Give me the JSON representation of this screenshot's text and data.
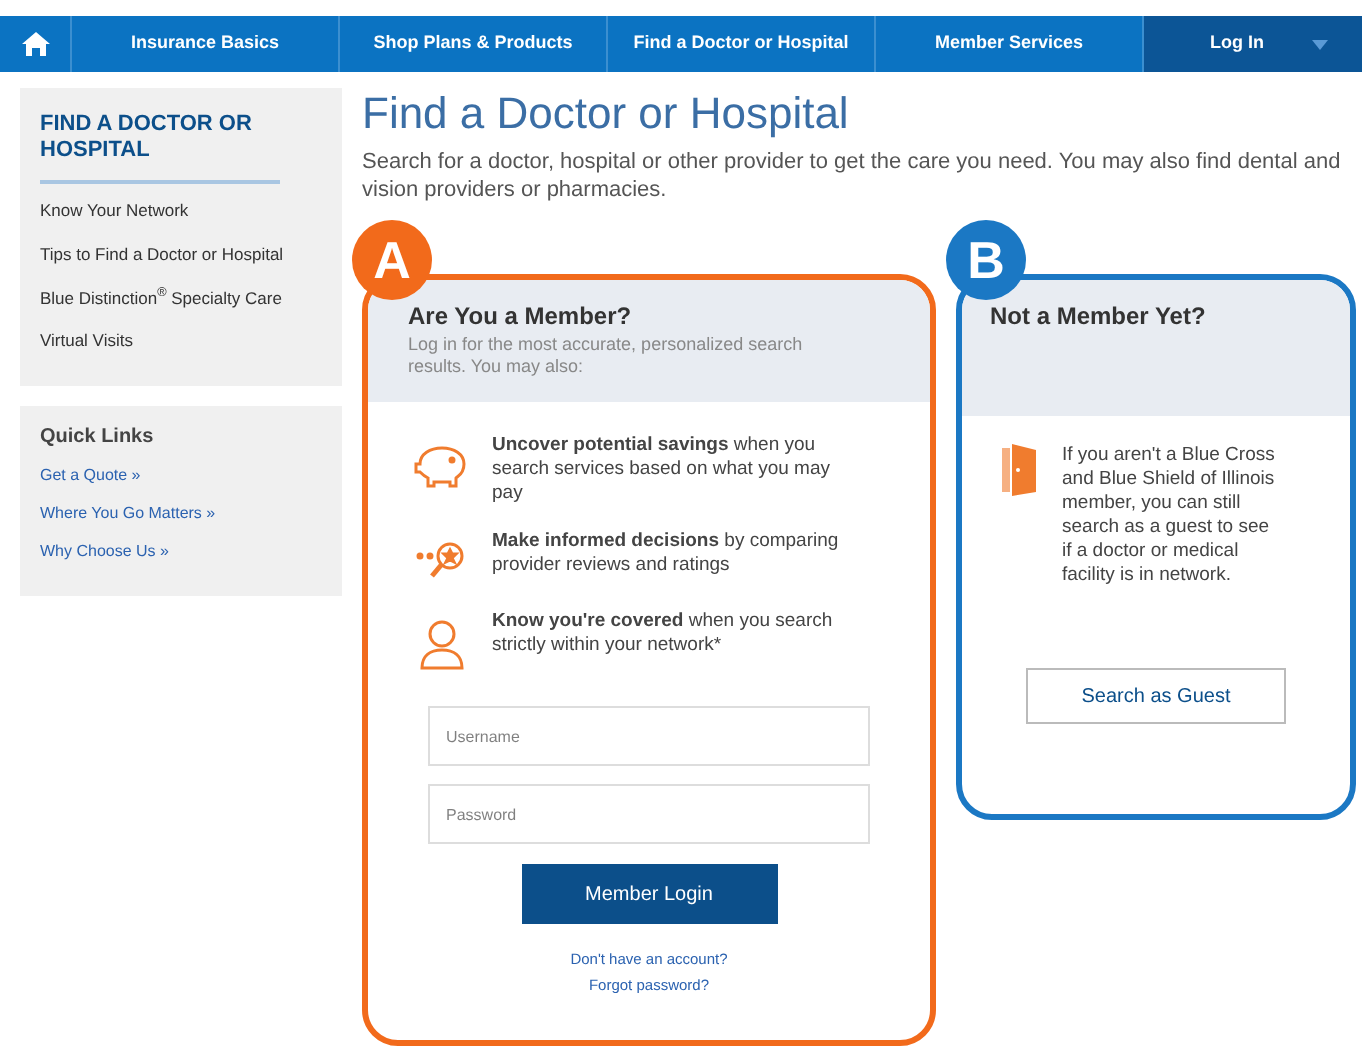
{
  "nav": {
    "items": [
      {
        "label": "Insurance Basics"
      },
      {
        "label": "Shop Plans & Products"
      },
      {
        "label": "Find a Doctor or Hospital"
      },
      {
        "label": "Member Services"
      }
    ],
    "login": "Log In"
  },
  "sidebar": {
    "heading": "FIND A DOCTOR OR HOSPITAL",
    "items": [
      "Know Your Network",
      "Tips to Find a Doctor or Hospital",
      "Blue Distinction$^{®}$ Specialty Care",
      "Virtual Visits"
    ],
    "quick_links": {
      "heading": "Quick Links",
      "items": [
        "Get a Quote »",
        "Where You Go Matters »",
        "Why Choose Us »"
      ]
    }
  },
  "page": {
    "title": "Find a Doctor or Hospital",
    "intro": "Search for a doctor, hospital or other provider to get the care you need. You may also find dental and vision providers or pharmacies."
  },
  "member_card": {
    "badge": "A",
    "title": "Are You a Member?",
    "subtitle": "Log in for the most accurate, personalized search results. You may also:",
    "benefits": [
      {
        "kind": "savings",
        "text": "**Uncover potential savings** when you search services based on what you may pay"
      },
      {
        "kind": "reviews",
        "text": "**Make informed decisions** by comparing provider reviews and ratings"
      },
      {
        "kind": "covered",
        "text": "**Know you're covered** when you search strictly within your network*"
      }
    ],
    "username": {
      "placeholder": "Username"
    },
    "password": {
      "placeholder": "Password"
    },
    "button": "Member Login",
    "links": [
      "Don't have an account?",
      "Forgot password?"
    ]
  },
  "guest_card": {
    "badge": "B",
    "title": "Not a Member Yet?",
    "text": "If you aren't a Blue Cross and Blue Shield of Illinois member, you can still search as a guest to see if a doctor or medical facility is in network.",
    "button": "Search as Guest"
  }
}
